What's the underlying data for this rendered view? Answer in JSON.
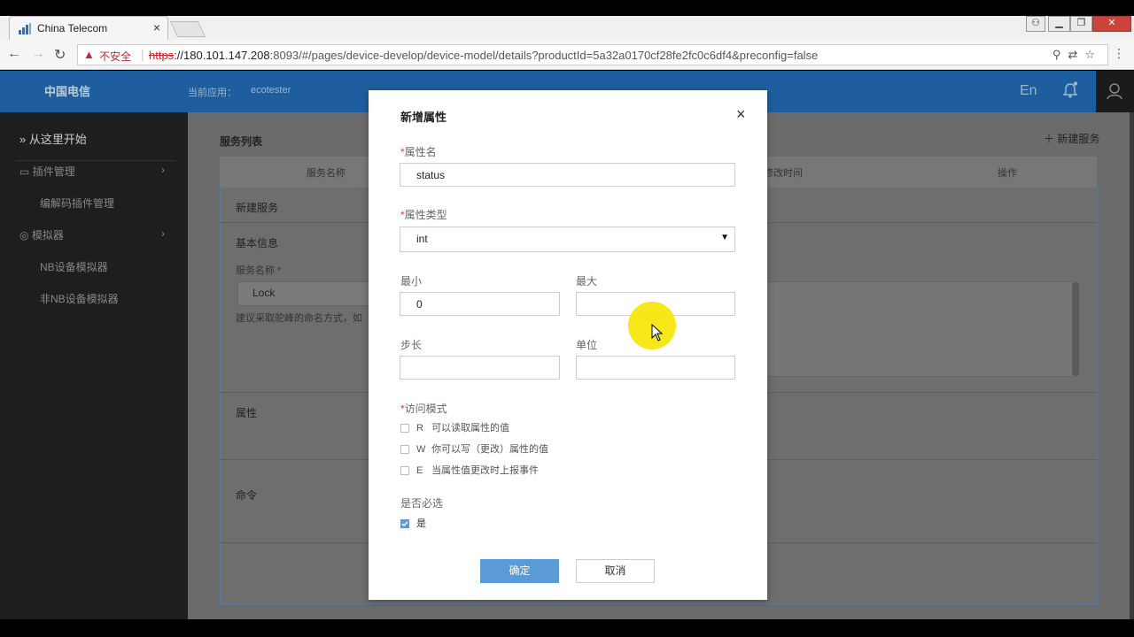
{
  "browser": {
    "tab_title": "China Telecom",
    "tab_close": "×",
    "url_insecure_label": "不安全",
    "url_proto": "https",
    "url_host": "://180.101.147.208",
    "url_rest": ":8093/#/pages/device-develop/device-model/details?productId=5a32a0170cf28fe2fc0c6df4&preconfig=false"
  },
  "header": {
    "logo_text": "中国电信",
    "current_app_label": "当前应用：",
    "current_app_value": "ecotester",
    "lang": "En"
  },
  "sidebar": {
    "start": "从这里开始",
    "items": [
      {
        "label": "插件管理"
      },
      {
        "label": "编解码插件管理"
      },
      {
        "label": "模拟器"
      },
      {
        "label": "NB设备模拟器"
      },
      {
        "label": "非NB设备模拟器"
      }
    ]
  },
  "main": {
    "service_list_title": "服务列表",
    "new_service_button": "＋ 新建服务",
    "columns": [
      "服务名称",
      "修改时间",
      "操作"
    ],
    "new_service_title": "新建服务",
    "basic_info": "基本信息",
    "service_name_label": "服务名称 *",
    "service_name_value": "Lock",
    "service_name_hint": "建议采取驼峰的命名方式，如",
    "property_section": "属性",
    "command_section": "命令"
  },
  "modal": {
    "title": "新增属性",
    "close": "×",
    "prop_name_label": "属性名",
    "prop_name_value": "status",
    "prop_type_label": "属性类型",
    "prop_type_value": "int",
    "min_label": "最小",
    "min_value": "0",
    "max_label": "最大",
    "max_value": "",
    "step_label": "步长",
    "step_value": "",
    "unit_label": "单位",
    "unit_value": "",
    "access_label": "访问模式",
    "access_modes": [
      {
        "letter": "R",
        "text": "可以读取属性的值",
        "checked": false
      },
      {
        "letter": "W",
        "text": "你可以写（更改）属性的值",
        "checked": false
      },
      {
        "letter": "E",
        "text": "当属性值更改时上报事件",
        "checked": false
      }
    ],
    "required_label": "是否必选",
    "required_option": "是",
    "ok": "确定",
    "cancel": "取消"
  },
  "colors": {
    "header_blue": "#1f5e9e",
    "primary_button": "#5b9bd5",
    "required_star": "#e53935",
    "cursor_highlight": "#f5e400"
  }
}
